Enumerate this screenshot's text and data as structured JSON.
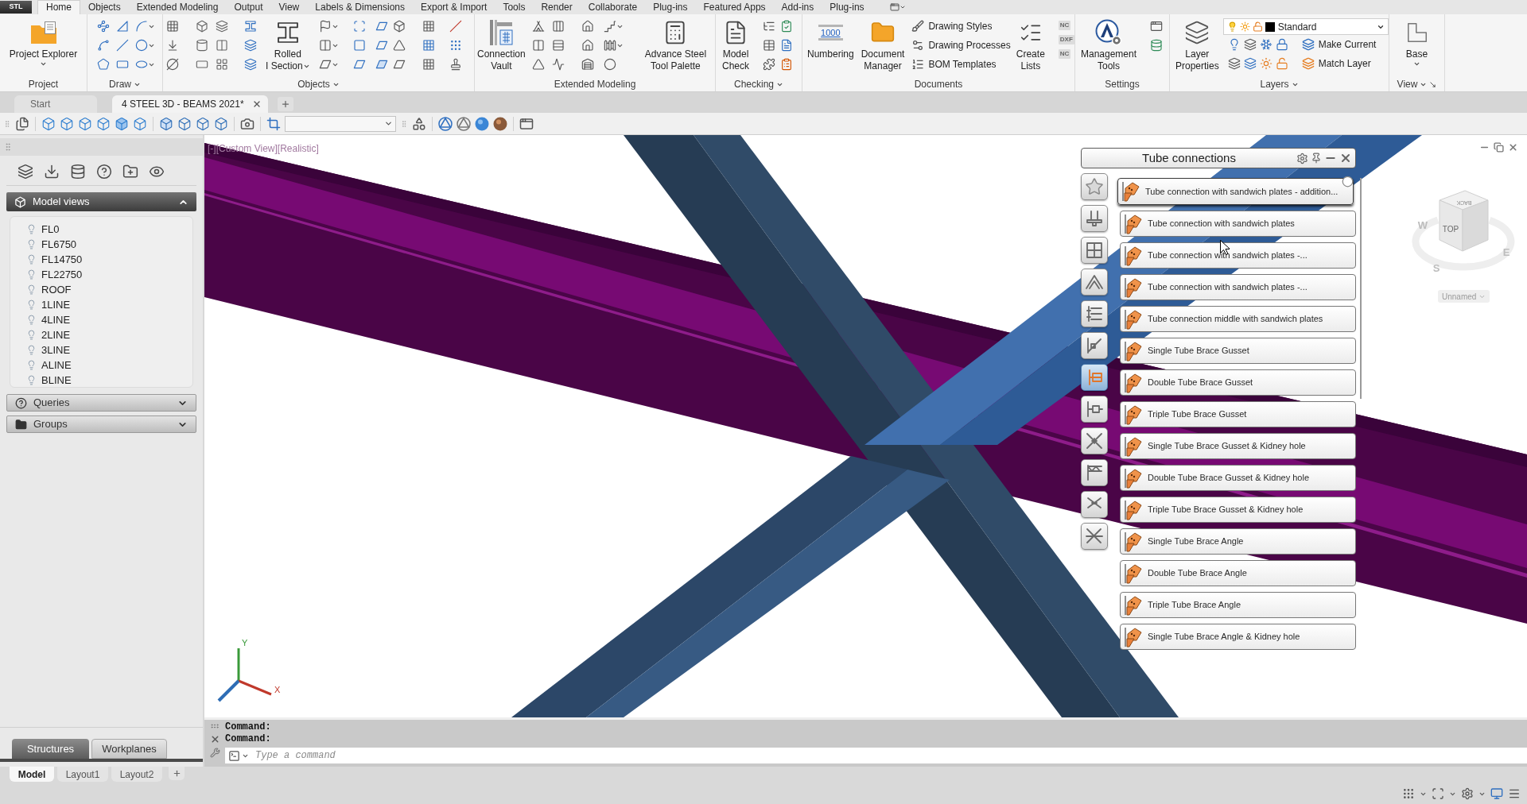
{
  "app_button": {
    "label": "STL"
  },
  "ribbon_tabs": [
    {
      "label": "Home",
      "selected": true
    },
    {
      "label": "Objects",
      "selected": false
    },
    {
      "label": "Extended Modeling",
      "selected": false
    },
    {
      "label": "Output",
      "selected": false
    },
    {
      "label": "View",
      "selected": false
    },
    {
      "label": "Labels & Dimensions",
      "selected": false
    },
    {
      "label": "Export & Import",
      "selected": false
    },
    {
      "label": "Tools",
      "selected": false
    },
    {
      "label": "Render",
      "selected": false
    },
    {
      "label": "Collaborate",
      "selected": false
    },
    {
      "label": "Plug-ins",
      "selected": false
    },
    {
      "label": "Featured Apps",
      "selected": false
    },
    {
      "label": "Add-ins",
      "selected": false
    },
    {
      "label": "Plug-ins",
      "selected": false
    }
  ],
  "ribbon_panels": [
    {
      "title": "Project",
      "expandable": false,
      "buttons": [
        {
          "kind": "large",
          "lines": [
            "Project Explorer"
          ],
          "menu": true
        }
      ]
    },
    {
      "title": "Draw",
      "expandable": true
    },
    {
      "title": "Objects",
      "expandable": true,
      "buttons": [
        {
          "kind": "large",
          "lines": [
            "Rolled",
            "I Section"
          ],
          "menu": true
        }
      ]
    },
    {
      "title": "Extended Modeling",
      "expandable": false,
      "buttons": [
        {
          "kind": "large",
          "lines": [
            "Connection",
            "Vault"
          ],
          "menu": false
        },
        {
          "kind": "large",
          "lines": [
            "Advance Steel",
            "Tool Palette"
          ],
          "menu": false
        }
      ]
    },
    {
      "title": "Checking",
      "expandable": true,
      "buttons": [
        {
          "kind": "large",
          "lines": [
            "Model",
            "Check"
          ],
          "menu": false
        }
      ]
    },
    {
      "title": "Documents",
      "expandable": false,
      "buttons": [
        {
          "kind": "large",
          "lines": [
            "Numbering"
          ],
          "icon_text": "1000",
          "menu": false
        },
        {
          "kind": "large",
          "lines": [
            "Document",
            "Manager"
          ],
          "menu": false
        },
        {
          "kind": "small",
          "lines": [
            "Drawing Styles"
          ]
        },
        {
          "kind": "small",
          "lines": [
            "Drawing Processes"
          ]
        },
        {
          "kind": "small",
          "lines": [
            "BOM Templates"
          ]
        },
        {
          "kind": "large",
          "lines": [
            "Create",
            "Lists"
          ],
          "menu": false
        }
      ],
      "tags": [
        "NC",
        "DXF",
        "NC"
      ]
    },
    {
      "title": "Settings",
      "expandable": false,
      "buttons": [
        {
          "kind": "large",
          "lines": [
            "Management",
            "Tools"
          ],
          "menu": false
        }
      ]
    },
    {
      "title": "Layers",
      "expandable": true,
      "buttons": [
        {
          "kind": "large",
          "lines": [
            "Layer",
            "Properties"
          ],
          "menu": false
        },
        {
          "kind": "dropdown",
          "lines": [
            "Standard"
          ]
        },
        {
          "kind": "small",
          "lines": [
            "Make Current"
          ]
        },
        {
          "kind": "small",
          "lines": [
            "Match Layer"
          ]
        }
      ]
    },
    {
      "title": "View",
      "expandable": true,
      "launcher": true,
      "buttons": [
        {
          "kind": "large",
          "lines": [
            "Base"
          ],
          "menu": true
        }
      ]
    }
  ],
  "document_tabs": [
    {
      "label": "Start",
      "selected": false
    },
    {
      "label": "4 STEEL 3D - BEAMS 2021*",
      "selected": true
    }
  ],
  "left_panel": {
    "sections": [
      {
        "title": "Model views",
        "expanded": true,
        "items": [
          "FL0",
          "FL6750",
          "FL14750",
          "FL22750",
          "ROOF",
          "1LINE",
          "4LINE",
          "2LINE",
          "3LINE",
          "ALINE",
          "BLINE"
        ]
      },
      {
        "title": "Queries",
        "expanded": false
      },
      {
        "title": "Groups",
        "expanded": false
      }
    ],
    "tabs": [
      {
        "label": "Structures",
        "selected": true
      },
      {
        "label": "Workplanes",
        "selected": false
      }
    ]
  },
  "viewport": {
    "view_label": "[-][Custom View][Realistic]",
    "palette": {
      "title": "Tube connections",
      "categories": [
        {
          "selected": false
        },
        {
          "selected": false
        },
        {
          "selected": false
        },
        {
          "selected": false
        },
        {
          "selected": false
        },
        {
          "selected": false
        },
        {
          "selected": true
        },
        {
          "selected": false
        },
        {
          "selected": false
        },
        {
          "selected": false
        },
        {
          "selected": false
        },
        {
          "selected": false
        }
      ],
      "items": [
        {
          "label": "Tube connection with sandwich plates - addition...",
          "selected": true
        },
        {
          "label": "Tube connection with sandwich plates",
          "selected": false
        },
        {
          "label": "Tube connection with sandwich plates -...",
          "selected": false
        },
        {
          "label": "Tube connection with sandwich plates -...",
          "selected": false
        },
        {
          "label": "Tube connection middle with sandwich plates",
          "selected": false
        },
        {
          "label": "Single Tube Brace Gusset",
          "selected": false
        },
        {
          "label": "Double Tube Brace Gusset",
          "selected": false
        },
        {
          "label": "Triple Tube Brace Gusset",
          "selected": false
        },
        {
          "label": "Single Tube Brace Gusset & Kidney hole",
          "selected": false
        },
        {
          "label": "Double Tube Brace Gusset & Kidney hole",
          "selected": false
        },
        {
          "label": "Triple Tube Brace Gusset & Kidney hole",
          "selected": false
        },
        {
          "label": "Single Tube Brace Angle",
          "selected": false
        },
        {
          "label": "Double Tube Brace Angle",
          "selected": false
        },
        {
          "label": "Triple Tube Brace Angle",
          "selected": false
        },
        {
          "label": "Single Tube Brace Angle & Kidney hole",
          "selected": false
        }
      ]
    },
    "viewcube": {
      "top_face": "TOP",
      "back_face": "BACK",
      "compass": [
        "W",
        "E",
        "S"
      ],
      "view_name": "Unnamed"
    },
    "axes": [
      "Y",
      "X"
    ]
  },
  "command_line": {
    "history": [
      "Command:",
      "Command:"
    ],
    "placeholder": "Type a command"
  },
  "layout_tabs": [
    {
      "label": "Model",
      "selected": true
    },
    {
      "label": "Layout1",
      "selected": false
    },
    {
      "label": "Layout2",
      "selected": false
    }
  ]
}
